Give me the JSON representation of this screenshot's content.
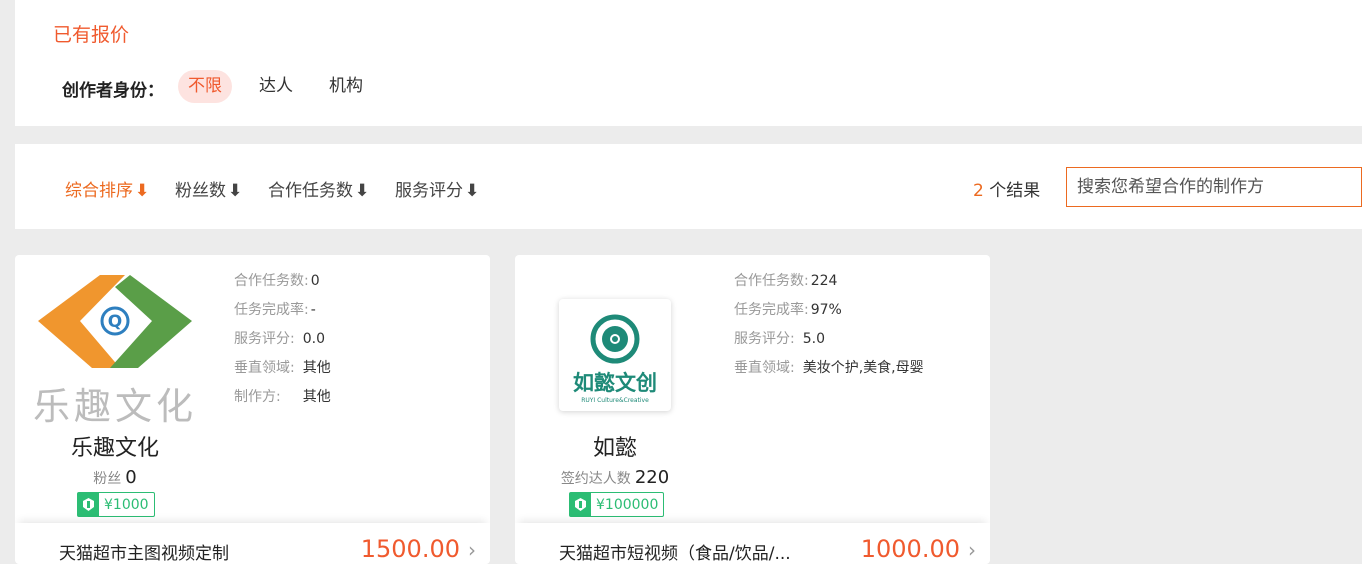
{
  "quoted": {
    "title": "已有报价",
    "filter_label": "创作者身份：",
    "chips": [
      "不限",
      "达人",
      "机构"
    ],
    "active_chip": "不限"
  },
  "sort": {
    "items": [
      "综合排序",
      "粉丝数",
      "合作任务数",
      "服务评分"
    ],
    "arrow": "⬇",
    "result_count": "2",
    "result_suffix": " 个结果",
    "search_placeholder": "搜索您希望合作的制作方"
  },
  "cards": [
    {
      "name": "乐趣文化",
      "logo_text": "乐趣文化",
      "stat_label": "粉丝",
      "stat_value": "0",
      "price_tag": "¥1000",
      "info": [
        {
          "label": "合作任务数:",
          "value": "0"
        },
        {
          "label": "任务完成率:",
          "value": "-"
        },
        {
          "label": "服务评分:",
          "value": "0.0"
        },
        {
          "label": "垂直领域:",
          "value": "其他"
        },
        {
          "label": "制作方:",
          "value": "其他"
        }
      ],
      "foot_title": "天猫超市主图视频定制",
      "foot_price": "1500.00",
      "colors": {
        "orange": "#f0962e",
        "green": "#5a9e48"
      }
    },
    {
      "name": "如懿",
      "logo_text": "如懿文创",
      "logo_sub": "RUYI Culture&Creative",
      "stat_label": "签约达人数",
      "stat_value": "220",
      "price_tag": "¥100000",
      "info": [
        {
          "label": "合作任务数:",
          "value": "224"
        },
        {
          "label": "任务完成率:",
          "value": "97%"
        },
        {
          "label": "服务评分:",
          "value": "5.0"
        },
        {
          "label": "垂直领域:",
          "value": "美妆个护,美食,母婴"
        }
      ],
      "foot_title": "天猫超市短视频（食品/饮品/...",
      "foot_price": "1000.00",
      "colors": {
        "teal": "#1e8a78"
      }
    }
  ],
  "icons": {
    "chevron": "chevron-right-icon",
    "tag": "badge-icon"
  },
  "colors": {
    "accent_orange": "#ec6a20",
    "accent_red": "#f05a2e",
    "tag_green": "#2cbd74"
  }
}
